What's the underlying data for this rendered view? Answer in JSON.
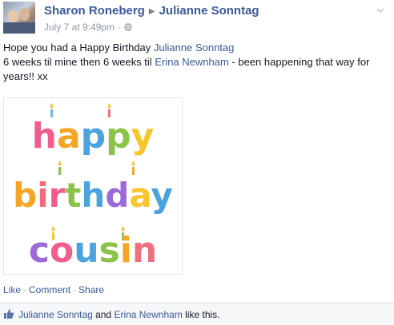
{
  "post": {
    "author": "Sharon Roneberg",
    "target": "Julianne Sonntag",
    "timestamp": "July 7 at 9:49pm",
    "separator": "·",
    "message": {
      "line1_prefix": "Hope you had a Happy Birthday ",
      "line1_mention": "Julianne Sonntag",
      "line2_prefix": "6 weeks til mine then 6 weeks til ",
      "line2_mention": "Erina Newnham",
      "line2_suffix": " - been happening that way for years!! xx"
    },
    "image": {
      "words": [
        "happy",
        "birthday",
        "cousin"
      ]
    },
    "actions": {
      "like": "Like",
      "comment": "Comment",
      "share": "Share",
      "separator": "·"
    },
    "likes": {
      "person1": "Julianne Sonntag",
      "conjunction": " and ",
      "person2": "Erina Newnham",
      "suffix": " like this."
    }
  },
  "icons": {
    "arrow": "right-triangle-icon",
    "privacy": "globe-icon",
    "menu": "chevron-down-icon",
    "like": "thumbs-up-icon"
  },
  "colors": {
    "link": "#3b5998",
    "meta": "#9197a3",
    "likes_bg": "#f6f7f9"
  }
}
